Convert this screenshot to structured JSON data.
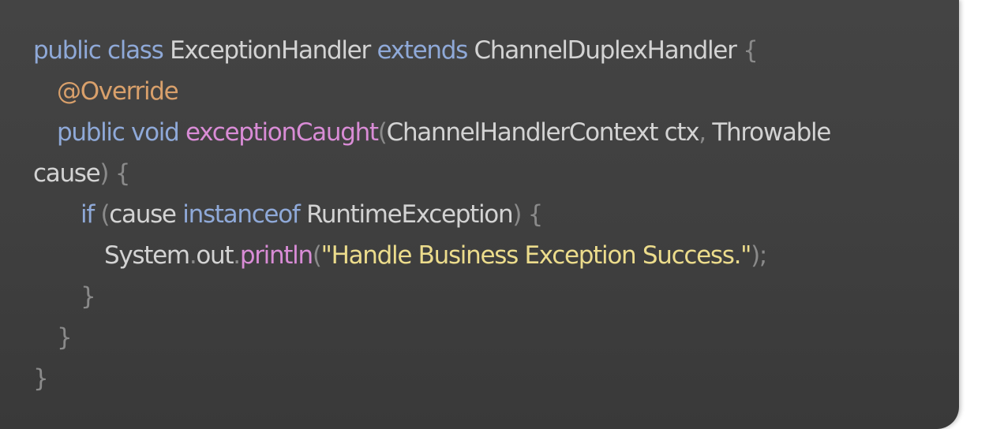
{
  "code": {
    "line1": {
      "kw_public": "public",
      "kw_class": "class",
      "class_name": "ExceptionHandler",
      "kw_extends": "extends",
      "parent_class": "ChannelDuplexHandler",
      "brace_open": "{"
    },
    "line2": {
      "annotation": "@Override"
    },
    "line3": {
      "kw_public": "public",
      "kw_void": "void",
      "method_name": "exceptionCaught",
      "paren_open": "(",
      "param_type_1": "ChannelHandlerContext",
      "param_name_1": "ctx",
      "comma": ",",
      "param_type_2": "Throwable"
    },
    "line4": {
      "param_name_2": "cause",
      "paren_close": ")",
      "brace_open": "{"
    },
    "line5": {
      "kw_if": "if",
      "paren_open": "(",
      "var_cause": "cause",
      "kw_instanceof": "instanceof",
      "type_name": "RuntimeException",
      "paren_close": ")",
      "brace_open": "{"
    },
    "line6": {
      "system": "System",
      "dot1": ".",
      "out": "out",
      "dot2": ".",
      "println": "println",
      "paren_open": "(",
      "string_literal": "\"Handle Business Exception Success.\"",
      "paren_close_semi": ");"
    },
    "line7": {
      "brace_close": "}"
    },
    "line8": {
      "brace_close": "}"
    },
    "line9": {
      "brace_close": "}"
    }
  },
  "colors": {
    "background": "#414141",
    "keyword": "#8fa9d8",
    "identifier": "#d3d3d3",
    "punctuation": "#8a8a8a",
    "annotation": "#d9a06b",
    "method": "#d98cd6",
    "string": "#ecdc8c"
  }
}
